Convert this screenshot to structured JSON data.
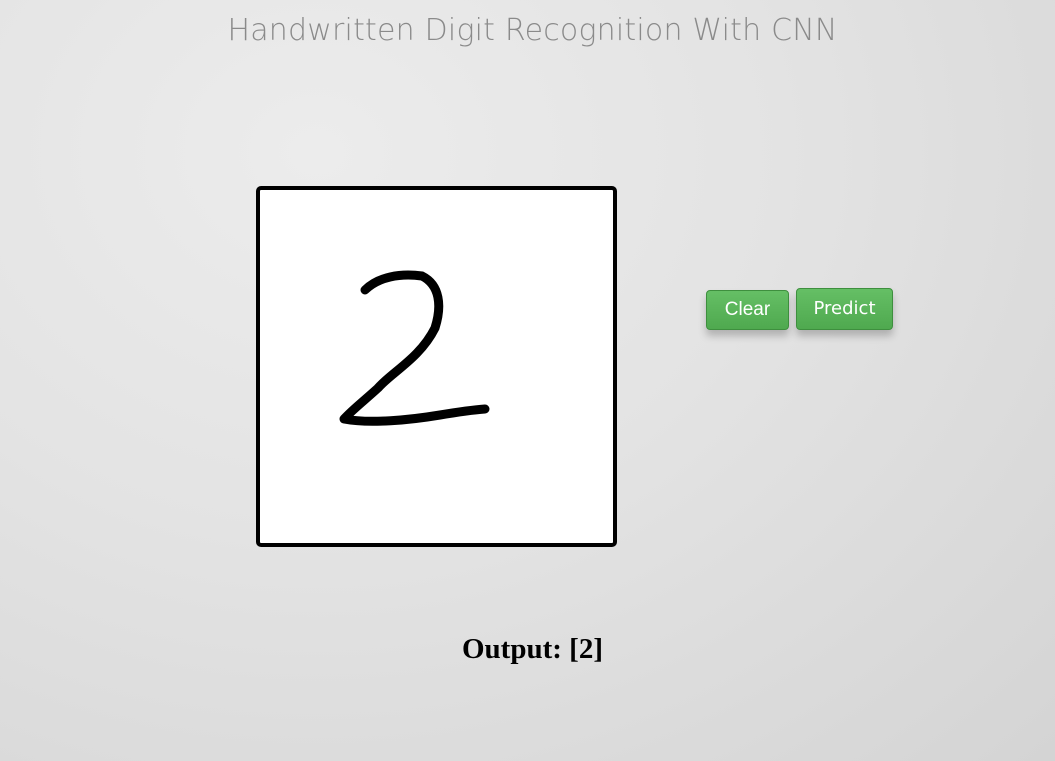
{
  "header": {
    "title": "Handwritten Digit Recognition With CNN"
  },
  "canvas": {
    "drawn_digit": "2",
    "stroke_color": "#000000",
    "background_color": "#ffffff"
  },
  "buttons": {
    "clear_label": "Clear",
    "predict_label": "Predict",
    "color": "#5cb85c"
  },
  "result": {
    "output_text": "Output: [2]"
  }
}
